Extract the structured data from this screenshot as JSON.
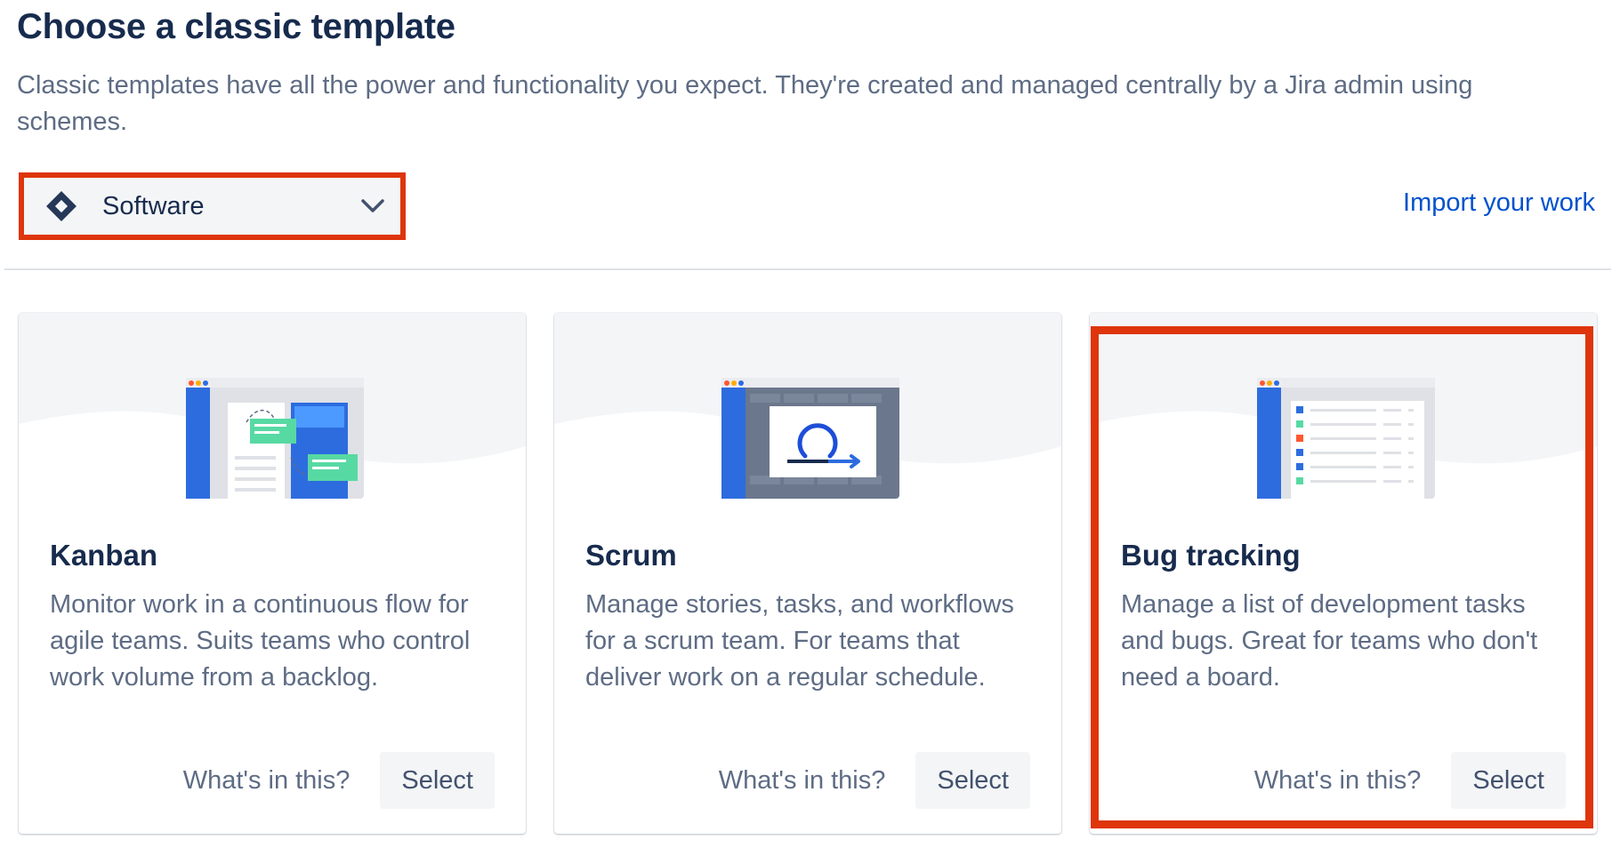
{
  "header": {
    "title": "Choose a classic template",
    "description": "Classic templates have all the power and functionality you expect. They're created and managed centrally by a Jira admin using schemes."
  },
  "product_select": {
    "value": "Software",
    "icon": "jira-diamond-icon"
  },
  "import_link": "Import your work",
  "colors": {
    "accent": "#0052cc",
    "highlight": "#de350b",
    "illustration_blue": "#2d6cdf",
    "illustration_green": "#57d9a3"
  },
  "cards": [
    {
      "title": "Kanban",
      "description": "Monitor work in a continuous flow for agile teams. Suits teams who control work volume from a backlog.",
      "whats_in_this": "What's in this?",
      "select_label": "Select",
      "illustration": "kanban-board-icon"
    },
    {
      "title": "Scrum",
      "description": "Manage stories, tasks, and workflows for a scrum team. For teams that deliver work on a regular schedule.",
      "whats_in_this": "What's in this?",
      "select_label": "Select",
      "illustration": "scrum-cycle-icon"
    },
    {
      "title": "Bug tracking",
      "description": "Manage a list of development tasks and bugs. Great for teams who don't need a board.",
      "whats_in_this": "What's in this?",
      "select_label": "Select",
      "illustration": "bug-list-icon"
    }
  ]
}
